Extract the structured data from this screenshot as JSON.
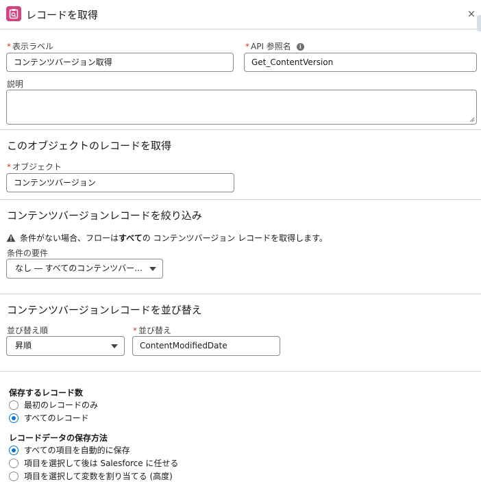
{
  "header": {
    "title": "レコードを取得",
    "close": "×"
  },
  "fields": {
    "required_mark": "*",
    "display_label": {
      "label": "表示ラベル",
      "value": "コンテンツバージョン取得"
    },
    "api_name": {
      "label": "API 参照名",
      "value": "Get_ContentVersion"
    },
    "description": {
      "label": "説明",
      "value": ""
    }
  },
  "object_section": {
    "title": "このオブジェクトのレコードを取得",
    "object_label": "オブジェクト",
    "object_value": "コンテンツバージョン"
  },
  "filter_section": {
    "title": "コンテンツバージョンレコードを絞り込み",
    "warning_prefix": "条件がない場合、フローは",
    "warning_bold": "すべて",
    "warning_suffix": "の コンテンツバージョン レコードを取得します。",
    "condition_label": "条件の要件",
    "condition_value": "なし ― すべてのコンテンツバー..."
  },
  "sort_section": {
    "title": "コンテンツバージョンレコードを並び替え",
    "order_label": "並び替え順",
    "order_value": "昇順",
    "sort_by_label": "並び替え",
    "sort_by_value": "ContentModifiedDate"
  },
  "store_count": {
    "label": "保存するレコード数",
    "options": [
      {
        "label": "最初のレコードのみ",
        "checked": false
      },
      {
        "label": "すべてのレコード",
        "checked": true
      }
    ]
  },
  "store_method": {
    "label": "レコードデータの保存方法",
    "options": [
      {
        "label": "すべての項目を自動的に保存",
        "checked": true
      },
      {
        "label": "項目を選択して後は Salesforce に任せる",
        "checked": false
      },
      {
        "label": "項目を選択して変数を割り当てる (高度)",
        "checked": false
      }
    ]
  },
  "colors": {
    "accent": "#0176d3",
    "header_icon": "#d4437f",
    "required": "#c23934",
    "warning": "#444444"
  },
  "icons": {
    "header": "get-records-icon",
    "info": "info-icon",
    "warning": "warning-icon",
    "dropdown": "chevron-down-icon"
  }
}
